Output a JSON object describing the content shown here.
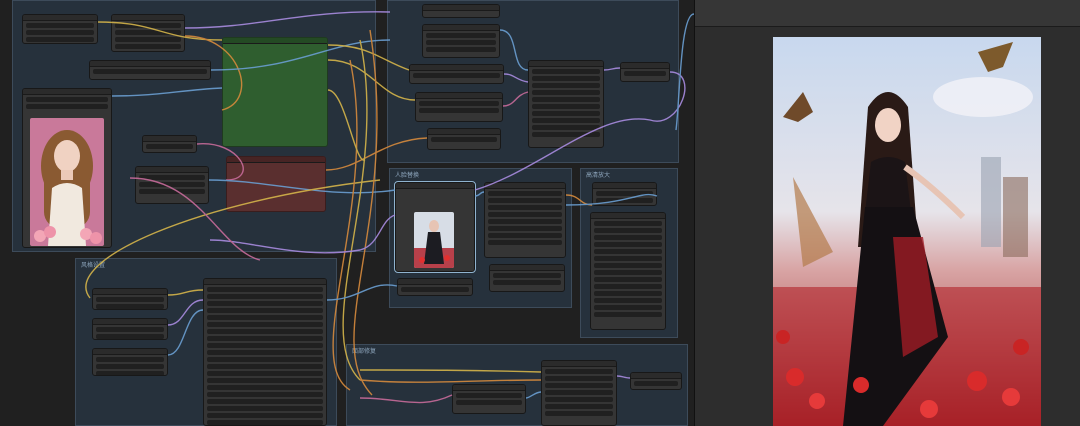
{
  "canvas": {
    "groups": [
      {
        "id": "group-load-portrait",
        "title": ""
      },
      {
        "id": "group-prompt",
        "title": ""
      },
      {
        "id": "group-face-swap",
        "title": "人脸替换"
      },
      {
        "id": "group-upscale",
        "title": "高清放大"
      },
      {
        "id": "group-settings",
        "title": "风格设置"
      },
      {
        "id": "group-face-detail",
        "title": "面部修复"
      }
    ]
  },
  "output_panel": {
    "title": ""
  },
  "colors": {
    "canvas_bg": "#202020",
    "group_bg": "#26313c",
    "node_bg": "#353535",
    "green_node": "#2f5e2f",
    "red_node": "#5a2f2f",
    "wire_yellow": "#d4b44a",
    "wire_blue": "#6a9ed1",
    "wire_pink": "#c76b9a",
    "wire_orange": "#d68a3c",
    "wire_purple": "#a88be0"
  },
  "icons": [
    "load-image-preview",
    "output-image"
  ]
}
